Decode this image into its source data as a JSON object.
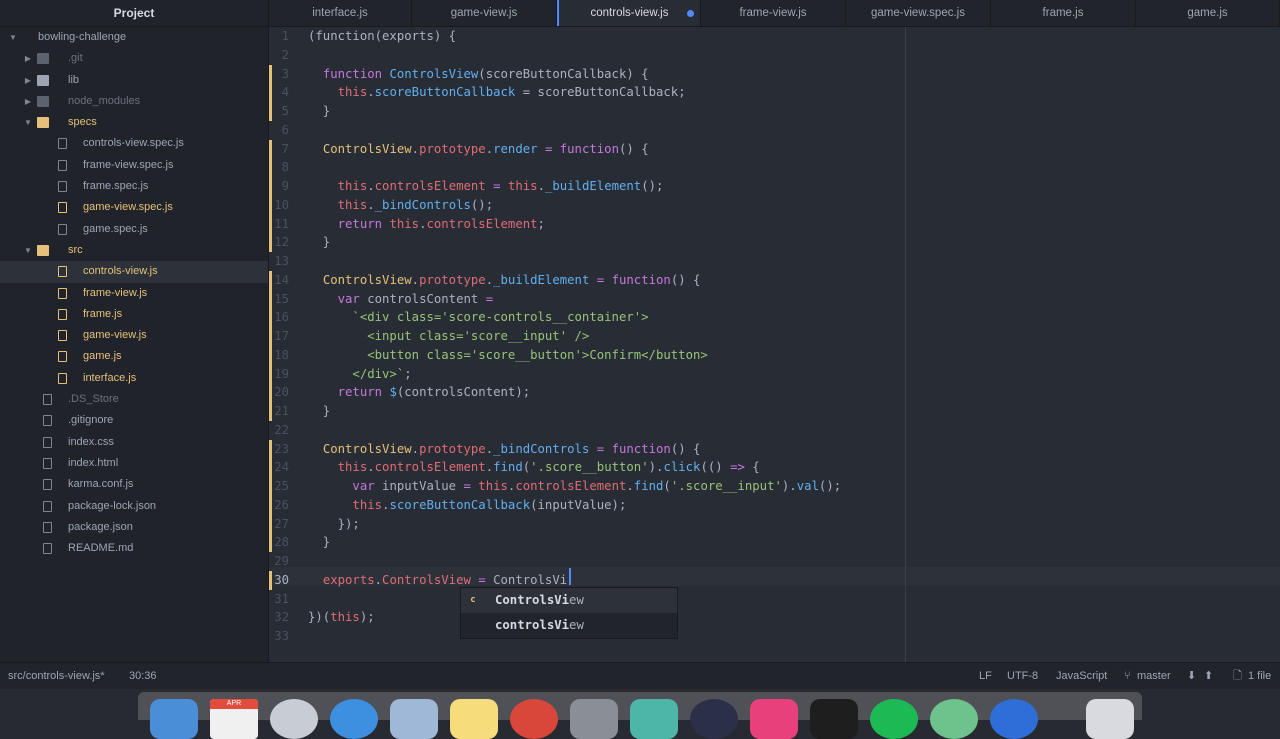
{
  "sidebar": {
    "title": "Project",
    "tree": [
      {
        "label": "bowling-challenge",
        "kind": "root",
        "depth": 0,
        "expanded": true,
        "status": "normal"
      },
      {
        "label": ".git",
        "kind": "folder",
        "depth": 1,
        "expanded": false,
        "status": "ignored"
      },
      {
        "label": "lib",
        "kind": "folder",
        "depth": 1,
        "expanded": false,
        "status": "normal"
      },
      {
        "label": "node_modules",
        "kind": "folder",
        "depth": 1,
        "expanded": false,
        "status": "ignored"
      },
      {
        "label": "specs",
        "kind": "folder",
        "depth": 1,
        "expanded": true,
        "status": "modified"
      },
      {
        "label": "controls-view.spec.js",
        "kind": "file",
        "depth": 2,
        "status": "normal"
      },
      {
        "label": "frame-view.spec.js",
        "kind": "file",
        "depth": 2,
        "status": "normal"
      },
      {
        "label": "frame.spec.js",
        "kind": "file",
        "depth": 2,
        "status": "normal"
      },
      {
        "label": "game-view.spec.js",
        "kind": "file",
        "depth": 2,
        "status": "modified"
      },
      {
        "label": "game.spec.js",
        "kind": "file",
        "depth": 2,
        "status": "normal"
      },
      {
        "label": "src",
        "kind": "folder",
        "depth": 1,
        "expanded": true,
        "status": "modified"
      },
      {
        "label": "controls-view.js",
        "kind": "file",
        "depth": 2,
        "status": "modified",
        "selected": true
      },
      {
        "label": "frame-view.js",
        "kind": "file",
        "depth": 2,
        "status": "modified"
      },
      {
        "label": "frame.js",
        "kind": "file",
        "depth": 2,
        "status": "modified"
      },
      {
        "label": "game-view.js",
        "kind": "file",
        "depth": 2,
        "status": "modified"
      },
      {
        "label": "game.js",
        "kind": "file",
        "depth": 2,
        "status": "modified"
      },
      {
        "label": "interface.js",
        "kind": "file",
        "depth": 2,
        "status": "modified"
      },
      {
        "label": ".DS_Store",
        "kind": "file",
        "depth": 1,
        "status": "ignored"
      },
      {
        "label": ".gitignore",
        "kind": "file",
        "depth": 1,
        "status": "normal"
      },
      {
        "label": "index.css",
        "kind": "file",
        "depth": 1,
        "status": "normal"
      },
      {
        "label": "index.html",
        "kind": "file",
        "depth": 1,
        "status": "normal"
      },
      {
        "label": "karma.conf.js",
        "kind": "file",
        "depth": 1,
        "status": "normal"
      },
      {
        "label": "package-lock.json",
        "kind": "file",
        "depth": 1,
        "status": "normal"
      },
      {
        "label": "package.json",
        "kind": "file",
        "depth": 1,
        "status": "normal"
      },
      {
        "label": "README.md",
        "kind": "file",
        "depth": 1,
        "status": "normal"
      }
    ]
  },
  "tabs": [
    {
      "label": "interface.js",
      "active": false,
      "modified": false
    },
    {
      "label": "game-view.js",
      "active": false,
      "modified": false
    },
    {
      "label": "controls-view.js",
      "active": true,
      "modified": true
    },
    {
      "label": "frame-view.js",
      "active": false,
      "modified": false
    },
    {
      "label": "game-view.spec.js",
      "active": false,
      "modified": false
    },
    {
      "label": "frame.js",
      "active": false,
      "modified": false
    },
    {
      "label": "game.js",
      "active": false,
      "modified": false
    }
  ],
  "editor": {
    "current_line": 30,
    "lines": [
      [
        [
          "p",
          "(function(exports) {"
        ]
      ],
      [],
      [
        [
          "p",
          "  "
        ],
        [
          "k",
          "function "
        ],
        [
          "f",
          "ControlsView"
        ],
        [
          "p",
          "(scoreButtonCallback) {"
        ]
      ],
      [
        [
          "p",
          "    "
        ],
        [
          "v",
          "this"
        ],
        [
          "p",
          "."
        ],
        [
          "f",
          "scoreButtonCallback"
        ],
        [
          "p",
          " = scoreButtonCallback;"
        ]
      ],
      [
        [
          "p",
          "  }"
        ]
      ],
      [],
      [
        [
          "p",
          "  "
        ],
        [
          "t",
          "ControlsView"
        ],
        [
          "p",
          "."
        ],
        [
          "v",
          "prototype"
        ],
        [
          "p",
          "."
        ],
        [
          "f",
          "render"
        ],
        [
          "p",
          " "
        ],
        [
          "k",
          "="
        ],
        [
          "p",
          " "
        ],
        [
          "k",
          "function"
        ],
        [
          "p",
          "() {"
        ]
      ],
      [],
      [
        [
          "p",
          "    "
        ],
        [
          "v",
          "this"
        ],
        [
          "p",
          "."
        ],
        [
          "v",
          "controlsElement"
        ],
        [
          "p",
          " "
        ],
        [
          "k",
          "="
        ],
        [
          "p",
          " "
        ],
        [
          "v",
          "this"
        ],
        [
          "p",
          "."
        ],
        [
          "f",
          "_buildElement"
        ],
        [
          "p",
          "();"
        ]
      ],
      [
        [
          "p",
          "    "
        ],
        [
          "v",
          "this"
        ],
        [
          "p",
          "."
        ],
        [
          "f",
          "_bindControls"
        ],
        [
          "p",
          "();"
        ]
      ],
      [
        [
          "p",
          "    "
        ],
        [
          "k",
          "return "
        ],
        [
          "v",
          "this"
        ],
        [
          "p",
          "."
        ],
        [
          "v",
          "controlsElement"
        ],
        [
          "p",
          ";"
        ]
      ],
      [
        [
          "p",
          "  }"
        ]
      ],
      [],
      [
        [
          "p",
          "  "
        ],
        [
          "t",
          "ControlsView"
        ],
        [
          "p",
          "."
        ],
        [
          "v",
          "prototype"
        ],
        [
          "p",
          "."
        ],
        [
          "f",
          "_buildElement"
        ],
        [
          "p",
          " "
        ],
        [
          "k",
          "="
        ],
        [
          "p",
          " "
        ],
        [
          "k",
          "function"
        ],
        [
          "p",
          "() {"
        ]
      ],
      [
        [
          "p",
          "    "
        ],
        [
          "k",
          "var "
        ],
        [
          "p",
          "controlsContent "
        ],
        [
          "k",
          "="
        ]
      ],
      [
        [
          "p",
          "      "
        ],
        [
          "s",
          "`<div class='score-controls__container'>"
        ]
      ],
      [
        [
          "s",
          "        <input class='score__input' />"
        ]
      ],
      [
        [
          "s",
          "        <button class='score__button'>Confirm</button>"
        ]
      ],
      [
        [
          "s",
          "      </div>`"
        ],
        [
          "p",
          ";"
        ]
      ],
      [
        [
          "p",
          "    "
        ],
        [
          "k",
          "return "
        ],
        [
          "f",
          "$"
        ],
        [
          "p",
          "(controlsContent);"
        ]
      ],
      [
        [
          "p",
          "  }"
        ]
      ],
      [],
      [
        [
          "p",
          "  "
        ],
        [
          "t",
          "ControlsView"
        ],
        [
          "p",
          "."
        ],
        [
          "v",
          "prototype"
        ],
        [
          "p",
          "."
        ],
        [
          "f",
          "_bindControls"
        ],
        [
          "p",
          " "
        ],
        [
          "k",
          "="
        ],
        [
          "p",
          " "
        ],
        [
          "k",
          "function"
        ],
        [
          "p",
          "() {"
        ]
      ],
      [
        [
          "p",
          "    "
        ],
        [
          "v",
          "this"
        ],
        [
          "p",
          "."
        ],
        [
          "v",
          "controlsElement"
        ],
        [
          "p",
          "."
        ],
        [
          "f",
          "find"
        ],
        [
          "p",
          "("
        ],
        [
          "s",
          "'.score__button'"
        ],
        [
          "p",
          ")."
        ],
        [
          "f",
          "click"
        ],
        [
          "p",
          "(() "
        ],
        [
          "k",
          "=>"
        ],
        [
          "p",
          " {"
        ]
      ],
      [
        [
          "p",
          "      "
        ],
        [
          "k",
          "var "
        ],
        [
          "p",
          "inputValue "
        ],
        [
          "k",
          "="
        ],
        [
          "p",
          " "
        ],
        [
          "v",
          "this"
        ],
        [
          "p",
          "."
        ],
        [
          "v",
          "controlsElement"
        ],
        [
          "p",
          "."
        ],
        [
          "f",
          "find"
        ],
        [
          "p",
          "("
        ],
        [
          "s",
          "'.score__input'"
        ],
        [
          "p",
          ")."
        ],
        [
          "f",
          "val"
        ],
        [
          "p",
          "();"
        ]
      ],
      [
        [
          "p",
          "      "
        ],
        [
          "v",
          "this"
        ],
        [
          "p",
          "."
        ],
        [
          "f",
          "scoreButtonCallback"
        ],
        [
          "p",
          "(inputValue);"
        ]
      ],
      [
        [
          "p",
          "    });"
        ]
      ],
      [
        [
          "p",
          "  }"
        ]
      ],
      [],
      [
        [
          "p",
          "  "
        ],
        [
          "v",
          "exports"
        ],
        [
          "p",
          "."
        ],
        [
          "v",
          "ControlsView"
        ],
        [
          "p",
          " "
        ],
        [
          "k",
          "="
        ],
        [
          "p",
          " ControlsVi"
        ]
      ],
      [],
      [
        [
          "p",
          "})("
        ],
        [
          "v",
          "this"
        ],
        [
          "p",
          ");"
        ]
      ],
      []
    ],
    "autocomplete": [
      {
        "badge": "c",
        "match": "ControlsVi",
        "rest": "ew",
        "selected": true
      },
      {
        "badge": "",
        "match": "controlsVi",
        "rest": "ew",
        "selected": false
      }
    ]
  },
  "statusbar": {
    "file_path": "src/controls-view.js*",
    "cursor_position": "30:36",
    "line_ending": "LF",
    "encoding": "UTF-8",
    "grammar": "JavaScript",
    "branch": "master",
    "git_changes": "1 file"
  },
  "dock": {
    "calendar_month": "APR"
  },
  "colors": {
    "accent": "#528bff",
    "modified": "#e5c07b",
    "keyword": "#c678dd",
    "function": "#61afef",
    "string": "#98c379",
    "variable": "#e06c75"
  }
}
